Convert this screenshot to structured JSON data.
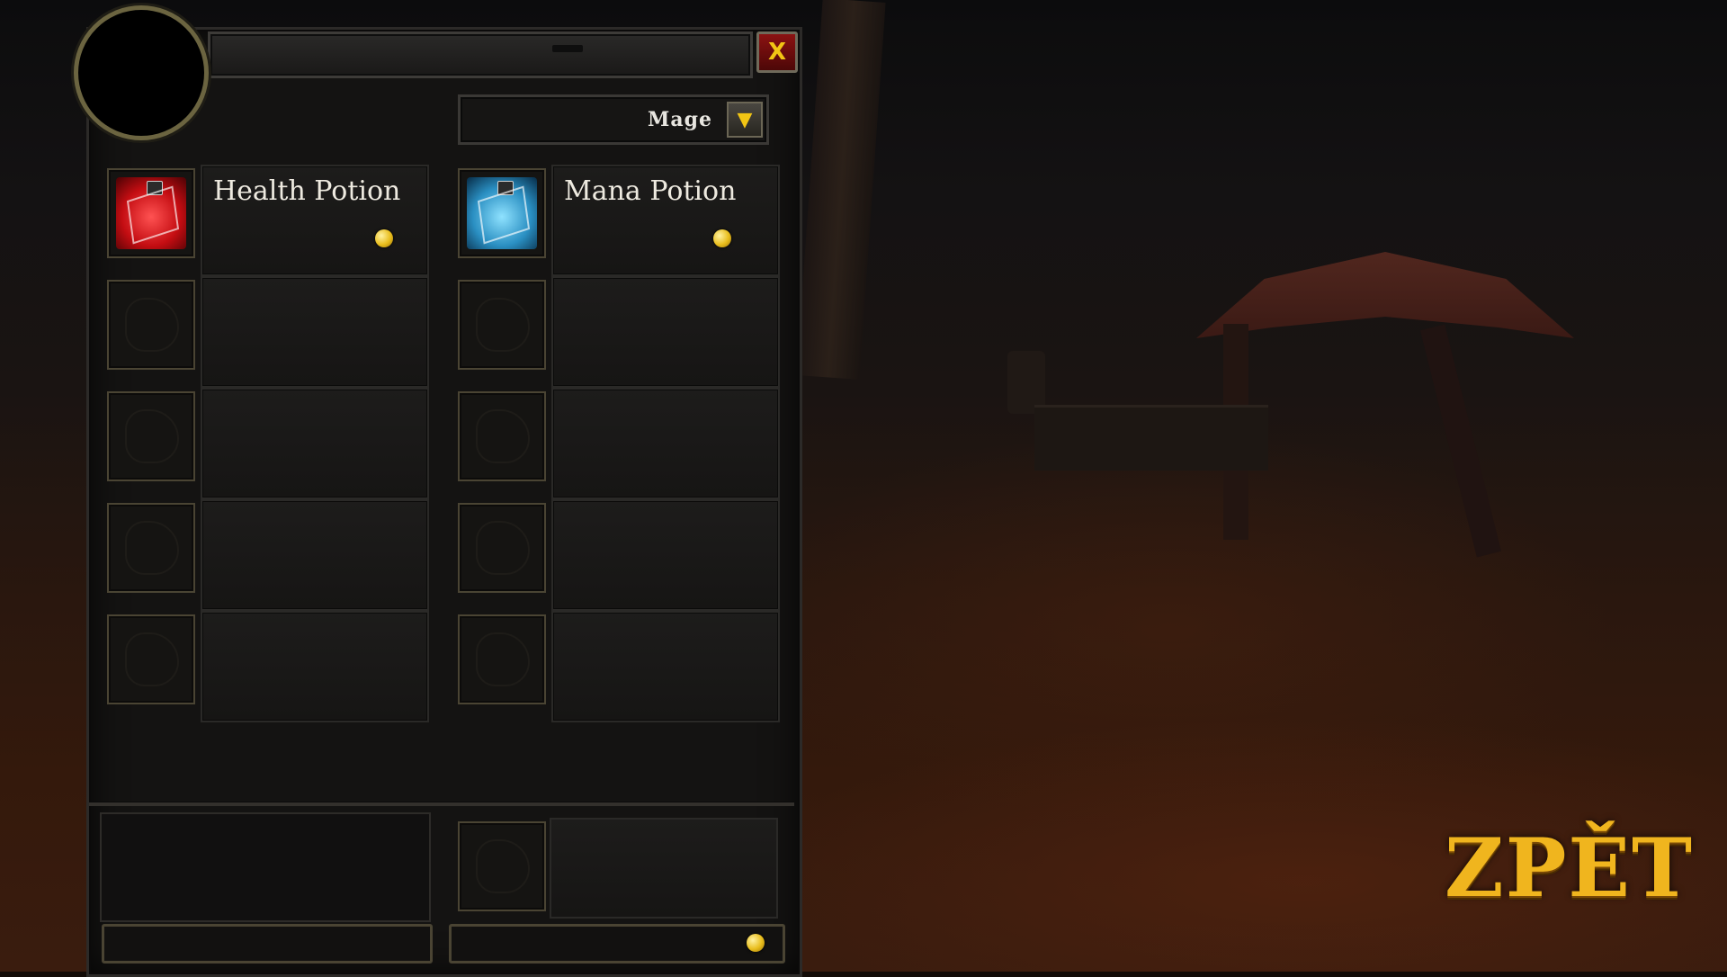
{
  "window": {
    "close_label": "X"
  },
  "class_select": {
    "selected": "Mage"
  },
  "items": [
    {
      "name": "Health Potion",
      "icon": "health-potion-icon",
      "color": "#c40d12"
    },
    {
      "name": "Mana Potion",
      "icon": "mana-potion-icon",
      "color": "#2a8fc2"
    }
  ],
  "back_button": {
    "label": "ZPĚT"
  },
  "colors": {
    "gold": "#f0b51e",
    "coin": "#e8bd1c"
  }
}
